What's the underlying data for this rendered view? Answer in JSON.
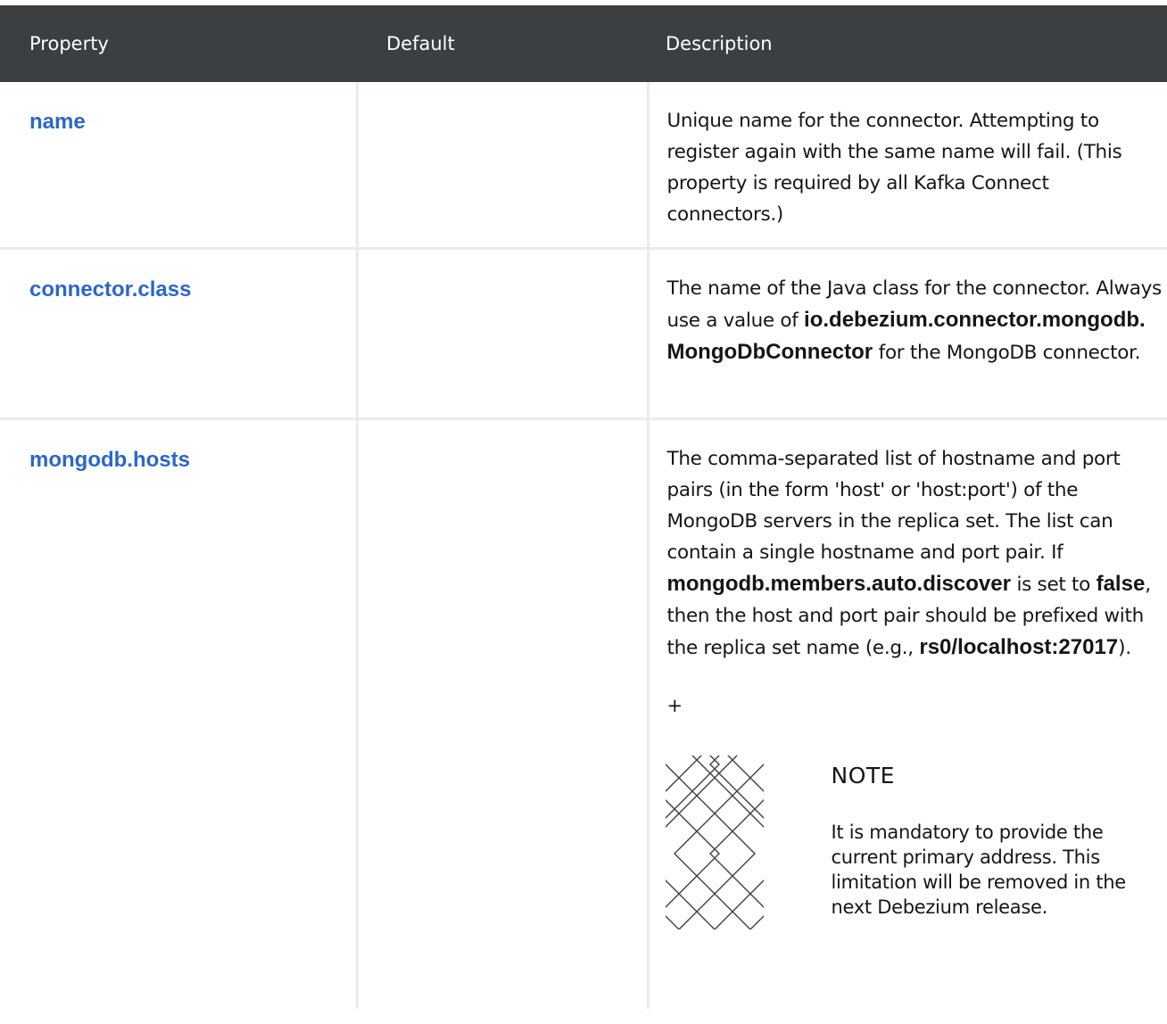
{
  "table": {
    "headers": [
      "Property",
      "Default",
      "Description"
    ],
    "rows": [
      {
        "property": "name",
        "default": "",
        "description": "Unique name for the connector. Attempting to register again with the same name will fail. (This property is required by all Kafka Connect connectors.)"
      },
      {
        "property": "connector.class",
        "default": "",
        "description_pre": "The name of the Java class for the connector. Always use a value of",
        "description_code": "io.debezium.connector.mongodb.MongoDbConnector",
        "description_post": "for the MongoDB connector."
      },
      {
        "property": "mongodb.hosts",
        "default": "",
        "description_1": "The comma-separated list of hostname and port pairs (in the form 'host' or 'host:port') of the MongoDB servers in the replica set. The list can contain a single hostname and port pair. If",
        "description_code_1": "mongodb.members.auto.discover",
        "description_2": "is set to",
        "description_code_2": "false",
        "description_3": ", then the host and port pair should be prefixed with the replica set name (e.g.,",
        "description_code_3": "rs0/localhost:27017",
        "description_4": ").",
        "plus": "+",
        "note": {
          "title": "NOTE",
          "body": "It is mandatory to provide the current primary address. This limitation will be removed in the next Debezium release.",
          "icon": "note-pattern-icon"
        }
      }
    ]
  },
  "colors": {
    "header_bg": "#3c3f42",
    "link": "#2b67c9",
    "border": "#ebebeb"
  }
}
